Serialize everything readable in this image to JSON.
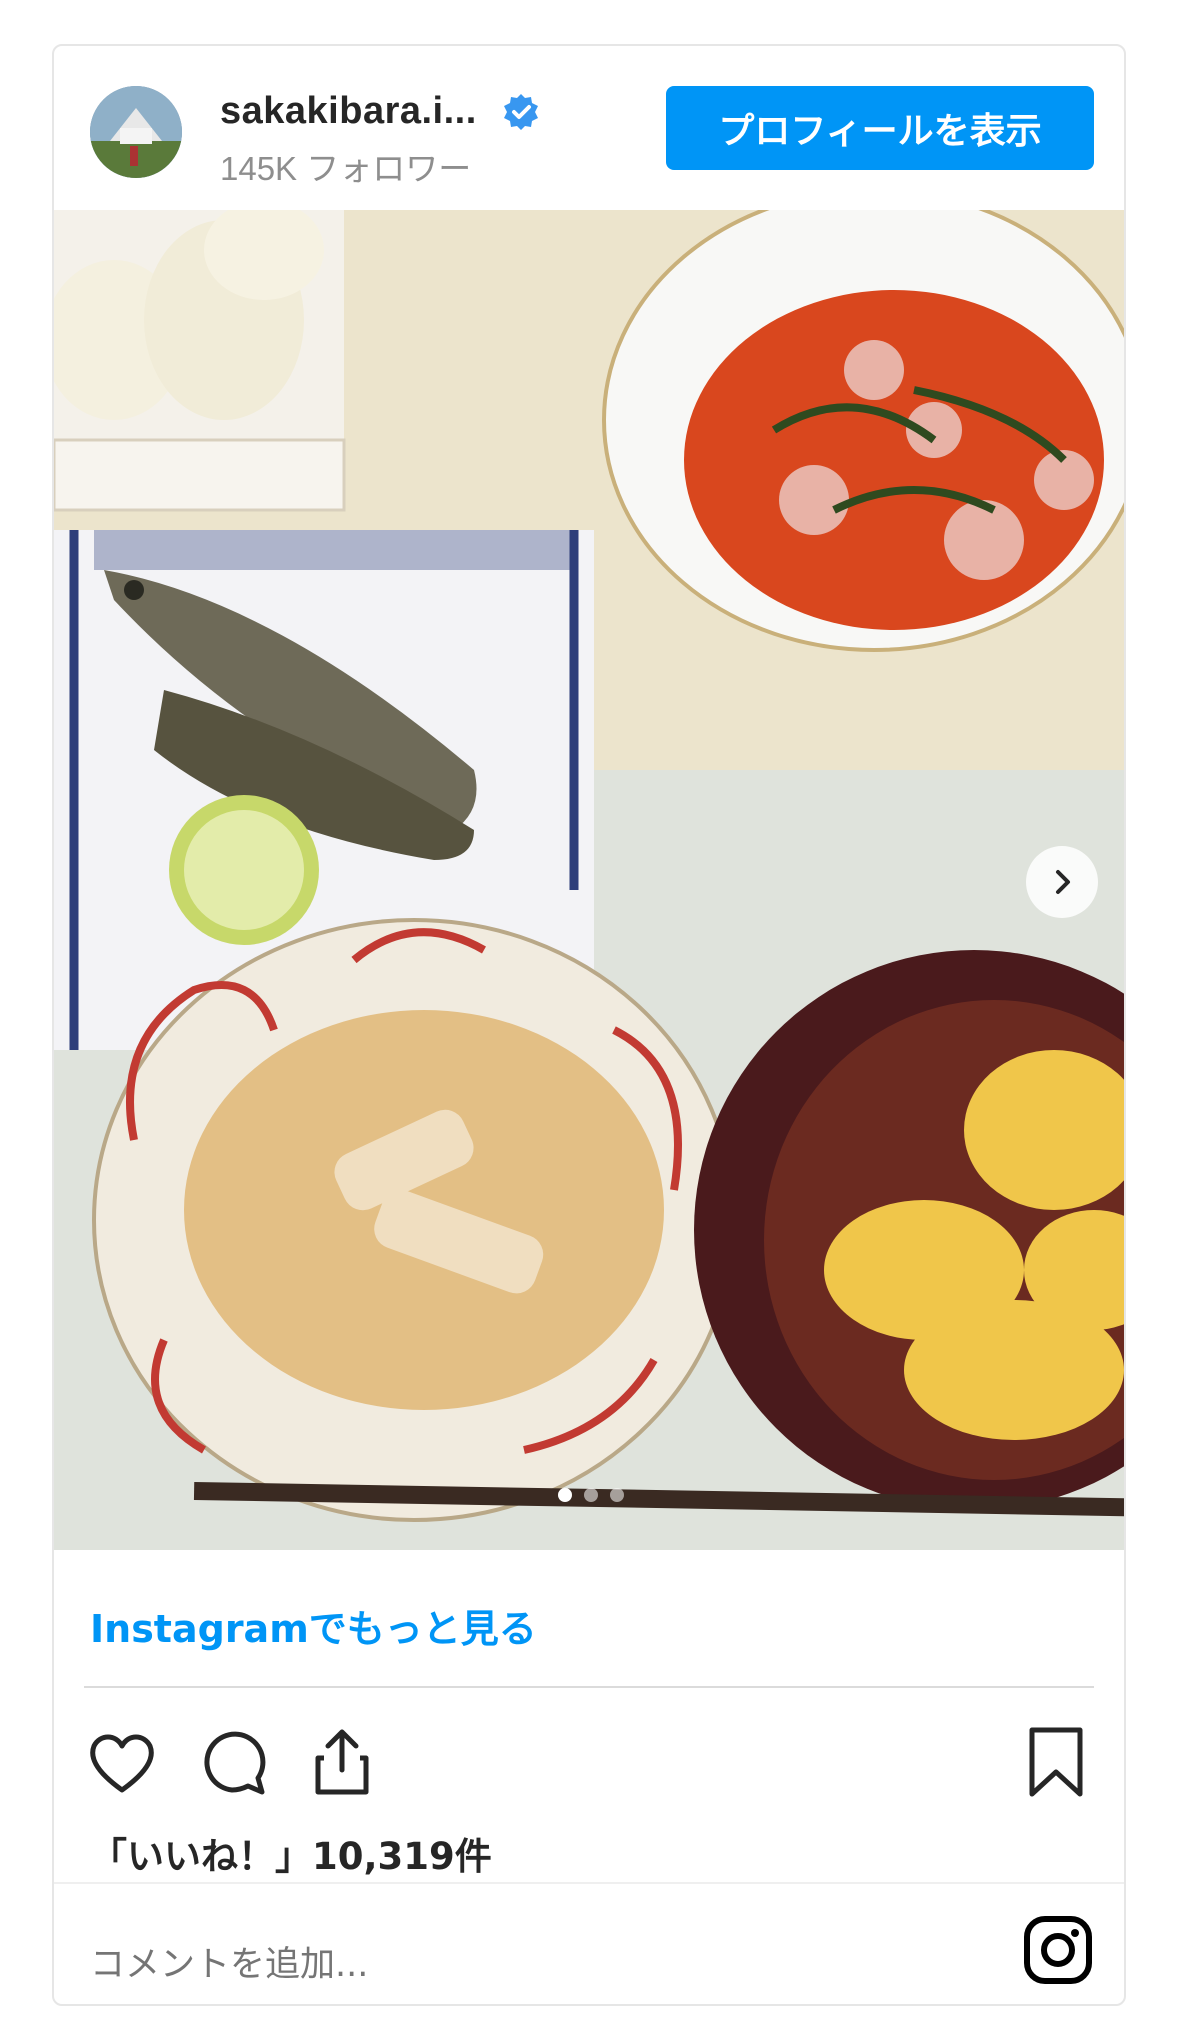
{
  "header": {
    "username": "sakakibara.i...",
    "followers": "145K フォロワー",
    "profile_button": "プロフィールを表示"
  },
  "post": {
    "carousel": {
      "count": 3,
      "active": 1
    },
    "more_link": "Instagramでもっと見る",
    "likes": "「いいね！」10,319件",
    "comment_placeholder": "コメントを追加..."
  },
  "colors": {
    "accent": "#0095f6",
    "text": "#262626",
    "muted": "#8e8e8e"
  },
  "icons": [
    "verified-badge-icon",
    "chevron-right-icon",
    "heart-icon",
    "comment-icon",
    "share-icon",
    "bookmark-icon",
    "instagram-icon"
  ]
}
